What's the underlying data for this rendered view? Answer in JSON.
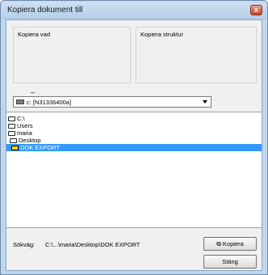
{
  "window": {
    "title": "Kopiera dokument till",
    "close_label": "x"
  },
  "groups": {
    "left_label": "Kopiera vad",
    "right_label": "Kopiera struktur"
  },
  "dash_text": "–",
  "drive": {
    "label": "c: [N31336400a]"
  },
  "tree": {
    "items": [
      {
        "label": "C:\\"
      },
      {
        "label": "Users"
      },
      {
        "label": "maria"
      },
      {
        "label": "Desktop"
      },
      {
        "label": "DOK EXPORT"
      }
    ]
  },
  "path": {
    "label": "Sökväg:",
    "value": "C:\\...\\maria\\Desktop\\DOK EXPORT"
  },
  "buttons": {
    "copy_label": "Kopiera",
    "close_label": "Stäng"
  }
}
